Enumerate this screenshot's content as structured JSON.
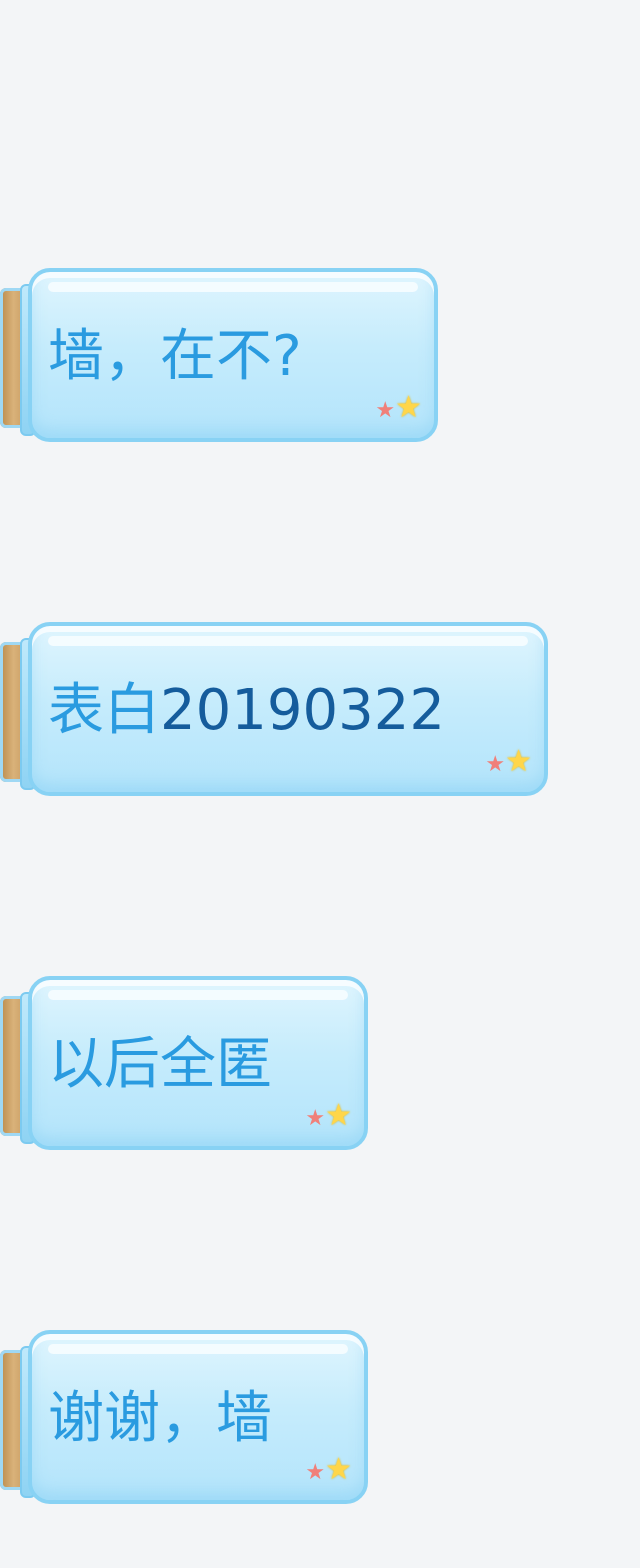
{
  "messages": [
    {
      "text": "墙，在不?",
      "number_part": ""
    },
    {
      "text": "表白",
      "number_part": "20190322"
    },
    {
      "text": "以后全匿",
      "number_part": ""
    },
    {
      "text": "谢谢，墙",
      "number_part": ""
    }
  ],
  "icons": {
    "star_red": "★",
    "star_yellow": "★"
  },
  "colors": {
    "background": "#f3f5f7",
    "text_blue": "#2a9be0",
    "number_blue": "#155c9c",
    "jar_border": "#88d2f4"
  }
}
